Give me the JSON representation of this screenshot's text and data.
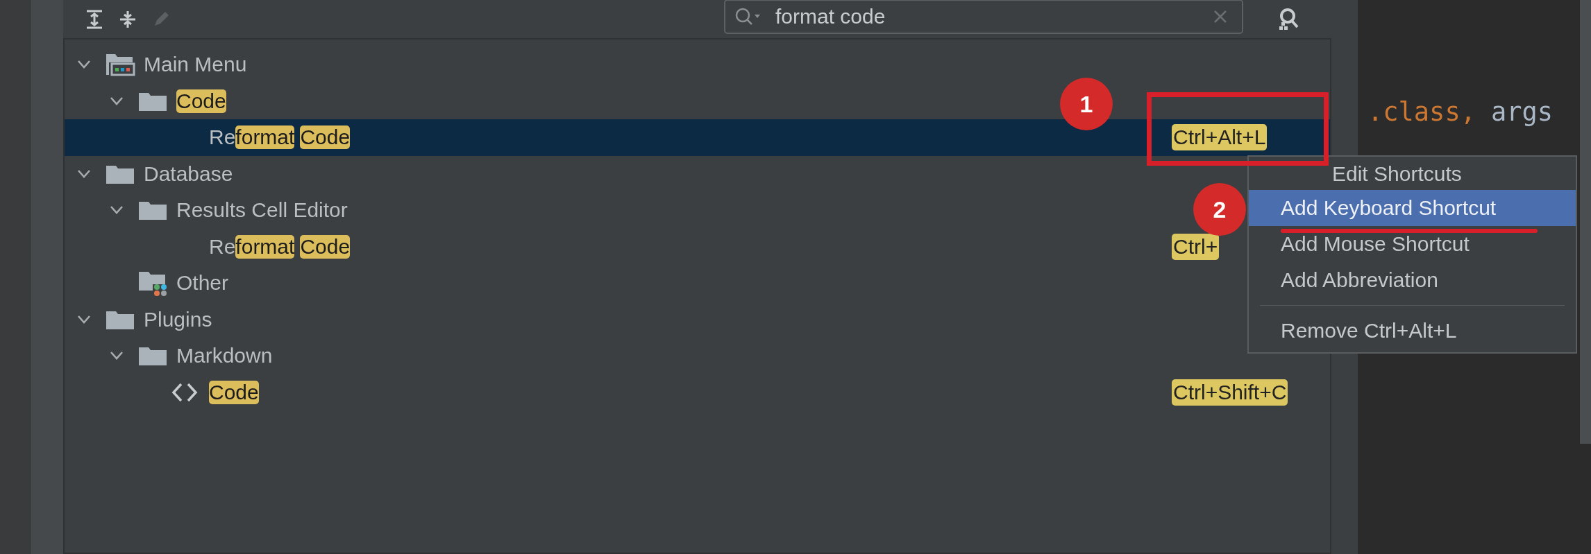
{
  "toolbar": {
    "buttons": [
      {
        "kind": "expand-all",
        "disabled": false
      },
      {
        "kind": "collapse-all",
        "disabled": false
      },
      {
        "kind": "edit",
        "disabled": true
      }
    ]
  },
  "search": {
    "value": "format code"
  },
  "tree": [
    {
      "kind": "menu-folder",
      "expanded": true,
      "selected": false,
      "segments": [
        {
          "text": "Main Menu",
          "match": false
        }
      ],
      "children": [
        {
          "kind": "folder",
          "expanded": true,
          "selected": false,
          "segments": [
            {
              "text": "Code",
              "match": true
            }
          ],
          "children": [
            {
              "kind": "action",
              "selected": true,
              "shortcut": "Ctrl+Alt+L",
              "segments": [
                {
                  "text": "Re",
                  "match": false
                },
                {
                  "text": "format",
                  "match": true
                },
                {
                  "text": "Code",
                  "match": true
                }
              ]
            }
          ]
        }
      ]
    },
    {
      "kind": "folder",
      "expanded": true,
      "selected": false,
      "segments": [
        {
          "text": "Database",
          "match": false
        }
      ],
      "children": [
        {
          "kind": "folder",
          "expanded": true,
          "selected": false,
          "segments": [
            {
              "text": "Results Cell Editor",
              "match": false
            }
          ],
          "children": [
            {
              "kind": "action",
              "selected": false,
              "shortcut": "Ctrl+",
              "segments": [
                {
                  "text": "Re",
                  "match": false
                },
                {
                  "text": "format",
                  "match": true
                },
                {
                  "text": "Code",
                  "match": true
                }
              ]
            }
          ]
        },
        {
          "kind": "group",
          "selected": false,
          "segments": [
            {
              "text": "Other",
              "match": false
            }
          ]
        }
      ]
    },
    {
      "kind": "folder",
      "expanded": true,
      "selected": false,
      "segments": [
        {
          "text": "Plugins",
          "match": false
        }
      ],
      "children": [
        {
          "kind": "folder",
          "expanded": true,
          "selected": false,
          "segments": [
            {
              "text": "Markdown",
              "match": false
            }
          ],
          "children": [
            {
              "kind": "code",
              "selected": false,
              "shortcut": "Ctrl+Shift+C",
              "segments": [
                {
                  "text": "Code",
                  "match": true
                }
              ]
            }
          ]
        }
      ]
    }
  ],
  "editor": {
    "tokens": [
      {
        "text": ".class,",
        "kind": "keyword"
      },
      {
        "text": "args",
        "kind": "plain"
      }
    ]
  },
  "context_menu": {
    "items": [
      {
        "kind": "header",
        "label": "Edit Shortcuts"
      },
      {
        "kind": "item",
        "label": "Add Keyboard Shortcut",
        "selected": true
      },
      {
        "kind": "item",
        "label": "Add Mouse Shortcut",
        "selected": false
      },
      {
        "kind": "item",
        "label": "Add Abbreviation",
        "selected": false
      },
      {
        "kind": "separator"
      },
      {
        "kind": "item",
        "label": "Remove Ctrl+Alt+L",
        "selected": false
      }
    ]
  },
  "annotations": [
    {
      "kind": "box-marker",
      "number": "1"
    },
    {
      "kind": "underline-marker",
      "number": "2"
    }
  ]
}
